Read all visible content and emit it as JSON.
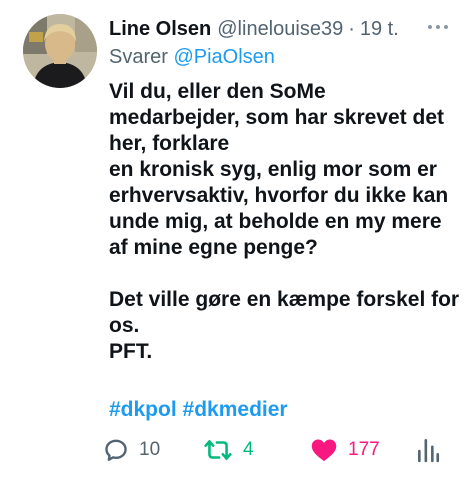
{
  "author": {
    "display_name": "Line Olsen",
    "handle": "@linelouise39",
    "separator": "·",
    "time": "19 t."
  },
  "reply": {
    "prefix": "Svarer",
    "mention": "@PiaOlsen"
  },
  "body_lines": [
    "Vil du, eller den SoMe",
    "medarbejder, som har skrevet det",
    "her, forklare",
    "en kronisk syg, enlig mor som er",
    "erhvervsaktiv, hvorfor du ikke kan",
    "unde mig, at beholde en my mere",
    "af mine egne penge?",
    "",
    "Det ville gøre en kæmpe forskel for",
    "os.",
    "PFT."
  ],
  "hashtags": [
    "#dkpol",
    "#dkmedier"
  ],
  "actions": {
    "replies": "10",
    "retweets": "4",
    "likes": "177"
  },
  "icons": {
    "more": "more-dots-icon",
    "reply": "reply-bubble-icon",
    "retweet": "retweet-arrows-icon",
    "like": "heart-icon",
    "views": "views-bar-chart-icon"
  },
  "colors": {
    "accent": "#1d9bf0",
    "text": "#0f1419",
    "muted": "#536471",
    "retweet": "#00ba7c",
    "like": "#f91880"
  }
}
